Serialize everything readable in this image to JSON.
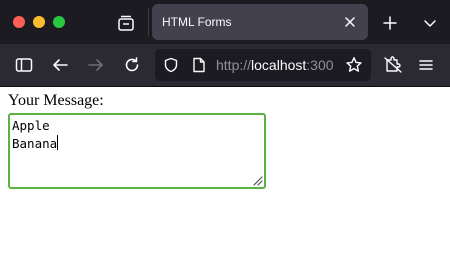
{
  "browser": {
    "tab": {
      "title": "HTML Forms"
    },
    "url": {
      "scheme": "http://",
      "host": "localhost",
      "rest": ":300"
    }
  },
  "page": {
    "label": "Your Message:",
    "textarea": {
      "lines": [
        "Apple",
        "Banana"
      ]
    }
  },
  "colors": {
    "tabbar_bg": "#1c1b22",
    "toolbar_bg": "#2b2a33",
    "active_tab_bg": "#42414d",
    "focus_border": "#5bb246"
  },
  "icons": {
    "window_controls": [
      "close-dot",
      "minimize-dot",
      "zoom-dot"
    ],
    "tab_bar": [
      "tabs-overview-icon",
      "close-icon",
      "plus-icon",
      "chevron-down-icon"
    ],
    "toolbar": [
      "sidebar-icon",
      "back-arrow-icon",
      "forward-arrow-icon",
      "reload-icon",
      "shield-icon",
      "page-icon",
      "star-icon",
      "extensions-icon",
      "menu-icon"
    ]
  }
}
